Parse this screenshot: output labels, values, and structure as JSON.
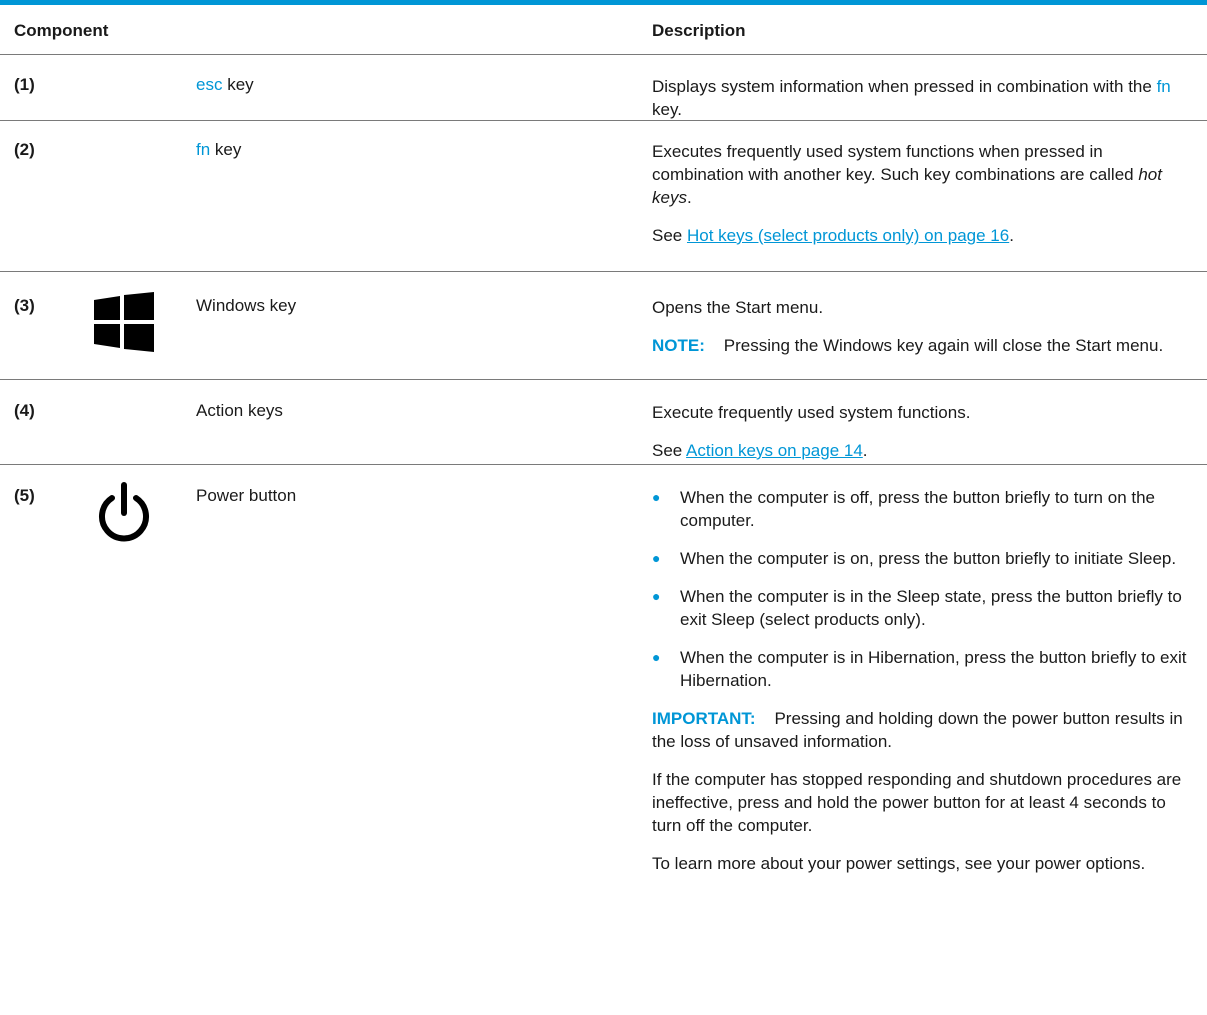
{
  "header": {
    "component": "Component",
    "description": "Description"
  },
  "rows": {
    "r1": {
      "num": "(1)",
      "comp_highlight": "esc",
      "comp_rest": " key",
      "desc": {
        "a": "Displays system information when pressed in combination with the ",
        "b": "fn",
        "c": " key."
      }
    },
    "r2": {
      "num": "(2)",
      "comp_highlight": "fn",
      "comp_rest": " key",
      "desc": {
        "a": "Executes frequently used system functions when pressed in combination with another key. Such key combinations are called ",
        "b": "hot keys",
        "c": ".",
        "see": "See ",
        "link": "Hot keys (select products only) on page 16",
        "after": "."
      }
    },
    "r3": {
      "num": "(3)",
      "icon": "windows-logo-icon",
      "comp": "Windows key",
      "desc": "Opens the Start menu.",
      "note_label": "NOTE:",
      "note_text": "Pressing the Windows key again will close the Start menu."
    },
    "r4": {
      "num": "(4)",
      "comp": "Action keys",
      "desc": "Execute frequently used system functions.",
      "see": "See ",
      "link": "Action keys on page 14",
      "after": "."
    },
    "r5": {
      "num": "(5)",
      "icon": "power-icon",
      "comp": "Power button",
      "bullets": [
        "When the computer is off, press the button briefly to turn on the computer.",
        "When the computer is on, press the button briefly to initiate Sleep.",
        "When the computer is in the Sleep state, press the button briefly to exit Sleep (select products only).",
        "When the computer is in Hibernation, press the button briefly to exit Hibernation."
      ],
      "important_label": "IMPORTANT:",
      "important_text": "Pressing and holding down the power button results in the loss of unsaved information.",
      "para1": "If the computer has stopped responding and shutdown procedures are ineffective, press and hold the power button for at least 4 seconds to turn off the computer.",
      "para2": "To learn more about your power settings, see your power options."
    }
  },
  "colors": {
    "accent": "#0096d6",
    "rule": "#7a7a7a",
    "text": "#1a1a1a"
  }
}
